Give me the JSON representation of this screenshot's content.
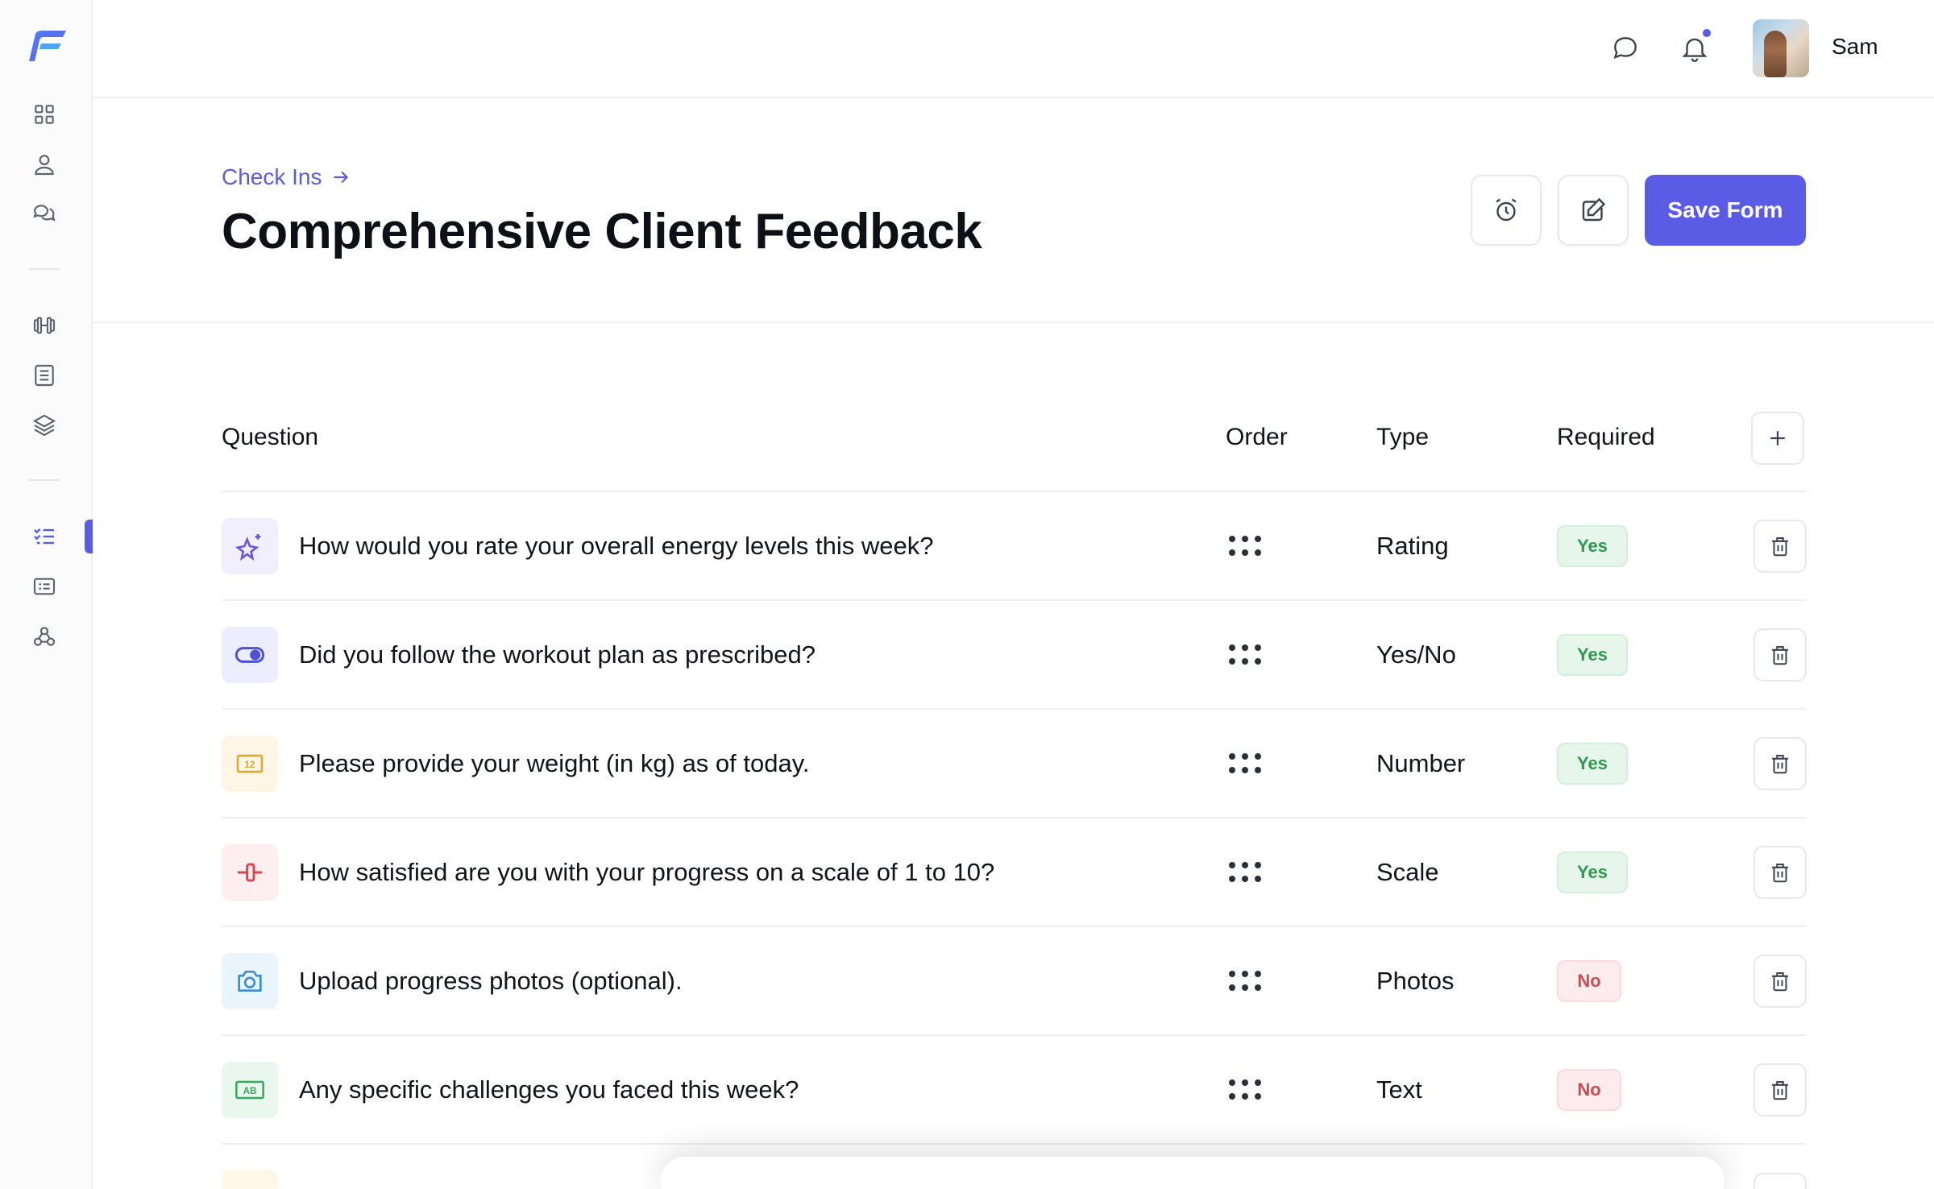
{
  "header": {
    "user_name": "Sam",
    "accent": "#5b5ce6"
  },
  "sidebar": {
    "items": [
      {
        "name": "dashboard-grid-icon"
      },
      {
        "name": "user-icon"
      },
      {
        "name": "chat-icon"
      },
      {
        "name": "dumbbell-icon"
      },
      {
        "name": "list-icon"
      },
      {
        "name": "layers-icon"
      },
      {
        "name": "checklist-icon",
        "active": true
      },
      {
        "name": "form-card-icon"
      },
      {
        "name": "webhook-icon"
      }
    ]
  },
  "page": {
    "breadcrumb": "Check Ins",
    "title": "Comprehensive Client Feedback",
    "save_label": "Save Form"
  },
  "table": {
    "headers": {
      "question": "Question",
      "order": "Order",
      "type": "Type",
      "required": "Required"
    },
    "rows": [
      {
        "icon": "sparkle-star-icon",
        "question": "How would you rate your overall energy levels this week?",
        "type": "Rating",
        "required": "Yes"
      },
      {
        "icon": "toggle-icon",
        "question": "Did you follow the workout plan as prescribed?",
        "type": "Yes/No",
        "required": "Yes"
      },
      {
        "icon": "number-icon",
        "question": "Please provide your weight (in kg) as of today.",
        "type": "Number",
        "required": "Yes"
      },
      {
        "icon": "scale-slider-icon",
        "question": "How satisfied are you with your progress on a scale of 1 to 10?",
        "type": "Scale",
        "required": "Yes"
      },
      {
        "icon": "camera-icon",
        "question": "Upload progress photos (optional).",
        "type": "Photos",
        "required": "No"
      },
      {
        "icon": "text-ab-icon",
        "question": "Any specific challenges you faced this week?",
        "type": "Text",
        "required": "No"
      }
    ]
  }
}
